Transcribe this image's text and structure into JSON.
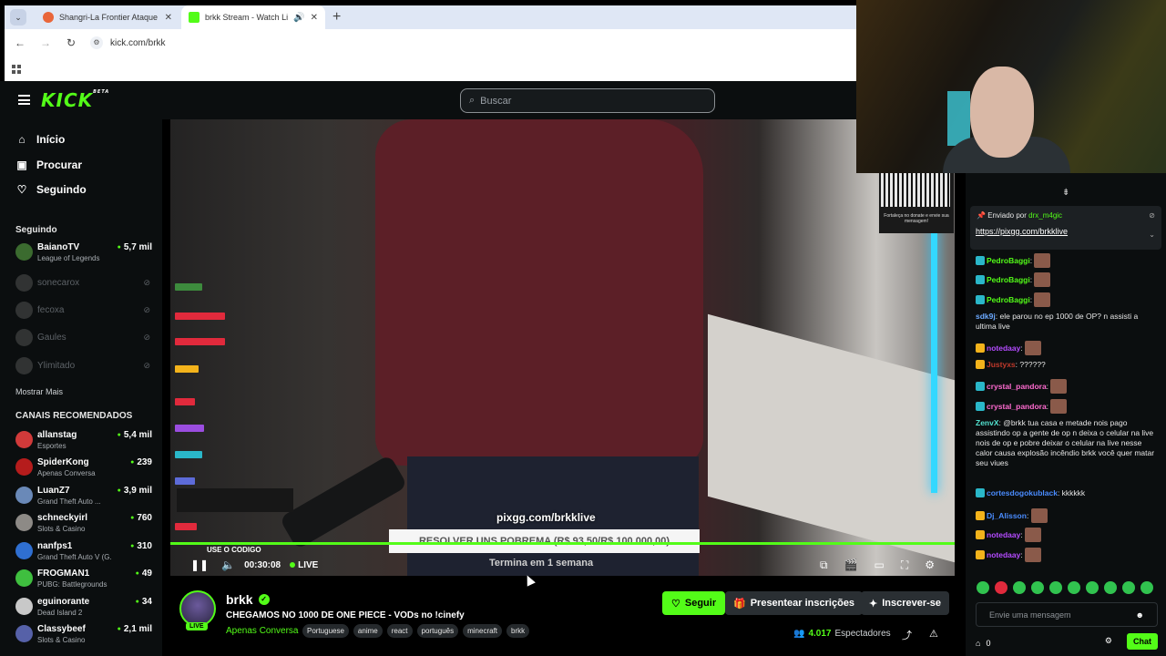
{
  "browser": {
    "tabs": [
      {
        "title": "Shangri-La Frontier Ataque No",
        "active": false
      },
      {
        "title": "brkk Stream - Watch Live o",
        "active": true
      }
    ],
    "url": "kick.com/brkk"
  },
  "header": {
    "logo": "KICK",
    "logo_badge": "BETA",
    "search_placeholder": "Buscar"
  },
  "sidebar": {
    "nav": [
      {
        "label": "Início",
        "icon": "home-icon"
      },
      {
        "label": "Procurar",
        "icon": "browse-icon"
      },
      {
        "label": "Seguindo",
        "icon": "heart-icon"
      }
    ],
    "following_title": "Seguindo",
    "following": [
      {
        "name": "BaianoTV",
        "game": "League of Legends",
        "viewers": "5,7 mil",
        "online": true,
        "color": "#3b6b2f"
      },
      {
        "name": "sonecarox",
        "online": false,
        "color": "#777"
      },
      {
        "name": "fecoxa",
        "online": false,
        "color": "#777"
      },
      {
        "name": "Gaules",
        "online": false,
        "color": "#777"
      },
      {
        "name": "Ylimitado",
        "online": false,
        "color": "#777"
      }
    ],
    "show_more": "Mostrar Mais",
    "recommended_title": "CANAIS RECOMENDADOS",
    "recommended": [
      {
        "name": "allanstag",
        "game": "Esportes",
        "viewers": "5,4 mil",
        "color": "#d13a3a"
      },
      {
        "name": "SpiderKong",
        "game": "Apenas Conversa",
        "viewers": "239",
        "color": "#b51c1c"
      },
      {
        "name": "LuanZ7",
        "game": "Grand Theft Auto ...",
        "viewers": "3,9 mil",
        "color": "#6a89b8"
      },
      {
        "name": "schneckyirl",
        "game": "Slots & Casino",
        "viewers": "760",
        "color": "#8d8a86"
      },
      {
        "name": "nanfps1",
        "game": "Grand Theft Auto V (G...",
        "viewers": "310",
        "color": "#2f6fd1"
      },
      {
        "name": "FROGMAN1",
        "game": "PUBG: Battlegrounds",
        "viewers": "49",
        "color": "#3fbf3f"
      },
      {
        "name": "eguinorante",
        "game": "Dead Island 2",
        "viewers": "34",
        "color": "#c8c8c8"
      },
      {
        "name": "Classybeef",
        "game": "Slots & Casino",
        "viewers": "2,1 mil",
        "color": "#5661a8"
      }
    ]
  },
  "video": {
    "qr_caption": "Fortaleça no donate e envie sua mensagem!",
    "pix_text": "pixgg.com/brkklive",
    "goal_text": "RESOLVER UNS POBREMA (R$ 93,50/R$ 100.000,00)",
    "ends_text": "Termina em 1 semana",
    "code_badge": "USE O CODIGO",
    "time": "00:30:08",
    "live_label": "LIVE"
  },
  "stream_info": {
    "channel": "brkk",
    "live_badge": "LIVE",
    "title": "CHEGAMOS NO 1000 DE ONE PIECE - VODs no !cinefy",
    "category": "Apenas Conversa",
    "tags": [
      "Portuguese",
      "anime",
      "react",
      "português",
      "minecraft",
      "brkk"
    ],
    "follow_label": "Seguir",
    "gift_label": "Presentear inscrições",
    "subscribe_label": "Inscrever-se",
    "viewers_count": "4.017",
    "viewers_label": "Espectadores"
  },
  "chat": {
    "pinned_by_label": "Enviado por",
    "pinned_user": "drx_m4gic",
    "pinned_link": "https://pixgg.com/brkklive",
    "messages": [
      {
        "user": "PedroBaggi",
        "text": "",
        "user_color": "#53fc18",
        "badge": "#2ab7c9",
        "emote": true
      },
      {
        "user": "PedroBaggi",
        "text": "",
        "user_color": "#53fc18",
        "badge": "#2ab7c9",
        "emote": true
      },
      {
        "user": "PedroBaggi",
        "text": "",
        "user_color": "#53fc18",
        "badge": "#2ab7c9",
        "emote": true
      },
      {
        "user": "sdk9j",
        "text": "ele parou no ep 1000 de OP? n assisti a ultima live",
        "user_color": "#6ba9ff",
        "badge": "",
        "emote": false
      },
      {
        "user": "notedaay",
        "text": "",
        "user_color": "#b44bff",
        "badge": "#f3b31b",
        "emote": true
      },
      {
        "user": "Justyxs",
        "text": "??????",
        "user_color": "#c0392b",
        "badge": "#f3b31b",
        "emote": false
      },
      {
        "user": "crystal_pandora",
        "text": "",
        "user_color": "#ff6bd0",
        "badge": "#2ab7c9",
        "emote": true
      },
      {
        "user": "crystal_pandora",
        "text": "",
        "user_color": "#ff6bd0",
        "badge": "#2ab7c9",
        "emote": true
      },
      {
        "user": "ZenvX",
        "text": "@brkk tua casa e metade nois pago assistindo op a gente de op n deixa o celular na live nois de op e pobre deixar o celular na live nesse calor causa explosão incêndio brkk você quer matar seu viues",
        "user_color": "#53e3d0",
        "badge": "",
        "emote": false
      },
      {
        "user": "cortesdogokublack",
        "text": "kkkkkk",
        "user_color": "#4a8cff",
        "badge": "#2ab7c9",
        "emote": false
      },
      {
        "user": "Dj_Alisson",
        "text": "",
        "user_color": "#4a8cff",
        "badge": "#f3b31b",
        "emote": true
      },
      {
        "user": "notedaay",
        "text": "",
        "user_color": "#b44bff",
        "badge": "#f3b31b",
        "emote": true
      },
      {
        "user": "notedaay",
        "text": "",
        "user_color": "#b44bff",
        "badge": "#f3b31b",
        "emote": true
      }
    ],
    "input_placeholder": "Envie uma mensagem",
    "points": "0",
    "chat_button": "Chat"
  }
}
